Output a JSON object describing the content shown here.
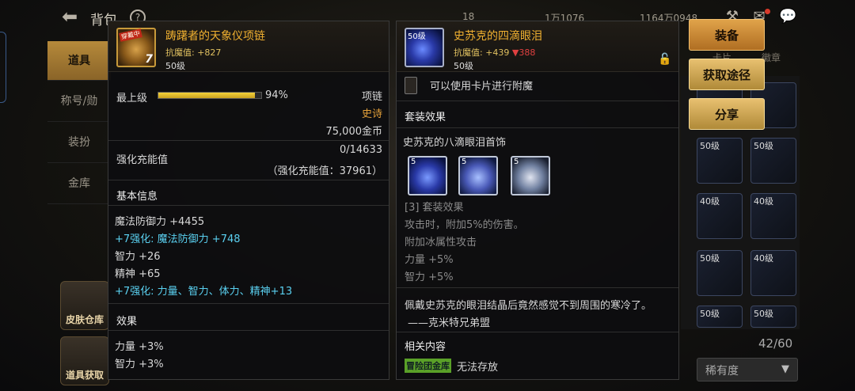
{
  "topbar": {
    "title": "背包",
    "currency1": "18",
    "currency2": "1万1076",
    "currency3": "1164万0948"
  },
  "sidebar": {
    "items": [
      {
        "label": "道具"
      },
      {
        "label": "称号/勋"
      },
      {
        "label": "装扮"
      },
      {
        "label": "金库"
      }
    ],
    "btn_skin": "皮肤仓库",
    "btn_item": "道具获取"
  },
  "grid": {
    "tab_card": "卡片",
    "tab_badge": "徽章",
    "slots": [
      {
        "level": ""
      },
      {
        "level": ""
      },
      {
        "level": "50级"
      },
      {
        "level": "50级"
      },
      {
        "level": "40级"
      },
      {
        "level": "40级"
      },
      {
        "level": "50级"
      },
      {
        "level": "40级"
      },
      {
        "level": "50级"
      },
      {
        "level": "50级"
      }
    ],
    "count": "42/60",
    "rarity_label": "稀有度"
  },
  "tip1": {
    "name": "踌躇者的天象仪项链",
    "badge": "穿戴中",
    "reinforce": "7",
    "stat": "抗魔值: +827",
    "level": "50级",
    "grade_label": "最上级",
    "grade_pct": "94%",
    "grade_value": 0.94,
    "type": "项链",
    "rarity": "史诗",
    "price": "75,000金币",
    "charge_label": "强化充能值",
    "charge_value": "0/14633",
    "charge_sub": "（强化充能值：37961）",
    "basic_header": "基本信息",
    "basic_lines": [
      {
        "text": "魔法防御力 +4455",
        "color": "white"
      },
      {
        "text": "+7强化: 魔法防御力 +748",
        "color": "cyan"
      },
      {
        "text": "智力 +26",
        "color": "white"
      },
      {
        "text": "精神 +65",
        "color": "white"
      },
      {
        "text": "+7强化: 力量、智力、体力、精神+13",
        "color": "cyan"
      }
    ],
    "effect_header": "效果",
    "effect_lines": [
      "力量 +3%",
      "智力 +3%"
    ]
  },
  "tip2": {
    "name": "史苏克的四滴眼泪",
    "level_tag": "50级",
    "stat_prefix": "抗魔值: +439",
    "stat_down": "▼388",
    "level": "50级",
    "card_text": "可以使用卡片进行附魔",
    "set_header": "套装效果",
    "set_name": "史苏克的八滴眼泪首饰",
    "set_icons": [
      {
        "tag": "5"
      },
      {
        "tag": "5"
      },
      {
        "tag": "5"
      }
    ],
    "set_effect_title": "[3] 套装效果",
    "set_lines": [
      "攻击时，附加5%的伤害。",
      "附加冰属性攻击",
      "力量 +5%",
      "智力 +5%"
    ],
    "flavor": "佩戴史苏克的眼泪结晶后竟然感觉不到周围的寒冷了。",
    "flavor_author": "——克米特兄弟盟",
    "related_header": "相关内容",
    "guild_tag": "冒险团金库",
    "related_text": "无法存放"
  },
  "actions": {
    "equip": "装备",
    "obtain": "获取途径",
    "share": "分享"
  }
}
